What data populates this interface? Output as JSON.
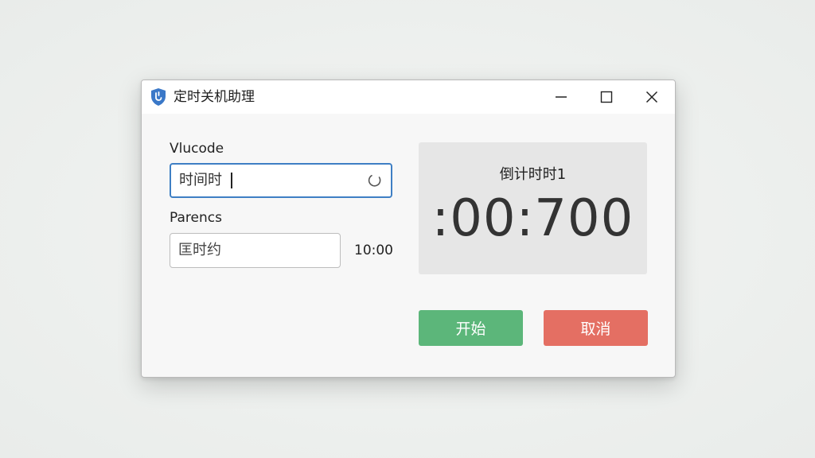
{
  "window": {
    "title": "定时关机助理"
  },
  "form": {
    "field1_label": "Vlucode",
    "field1_value": "时间时",
    "field2_label": "Parencs",
    "field2_value": "匡时约",
    "field2_side_value": "10:00"
  },
  "countdown": {
    "label": "倒计时时1",
    "time": ":00:700"
  },
  "actions": {
    "start_label": "开始",
    "cancel_label": "取消"
  },
  "colors": {
    "start": "#5cb67a",
    "cancel": "#e46f63",
    "focus": "#3f7fc4",
    "app_icon": "#3a78c8"
  },
  "icons": {
    "app": "shield-icon",
    "minimize": "minimize-icon",
    "maximize": "maximize-icon",
    "close": "close-icon",
    "loading": "spinner-icon"
  }
}
